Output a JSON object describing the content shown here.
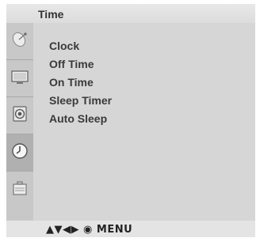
{
  "menu": {
    "title": "Time",
    "items": [
      {
        "label": "Clock"
      },
      {
        "label": "Off Time"
      },
      {
        "label": "On Time"
      },
      {
        "label": "Sleep Timer"
      },
      {
        "label": "Auto Sleep"
      }
    ]
  },
  "sidebar": {
    "icons": [
      {
        "name": "satellite-dish-icon",
        "active": false
      },
      {
        "name": "picture-icon",
        "active": false
      },
      {
        "name": "audio-icon",
        "active": false
      },
      {
        "name": "clock-icon",
        "active": true
      },
      {
        "name": "option-icon",
        "active": false
      }
    ]
  },
  "footer": {
    "hint": "▲▼◀▶ ◉ MENU"
  },
  "colors": {
    "panel": "#d6d6d6",
    "sidebar": "#c8c8c8",
    "active_tab": "#b0b0b0",
    "title_bar": "#e0e0e0",
    "text": "#3a3a3a"
  }
}
